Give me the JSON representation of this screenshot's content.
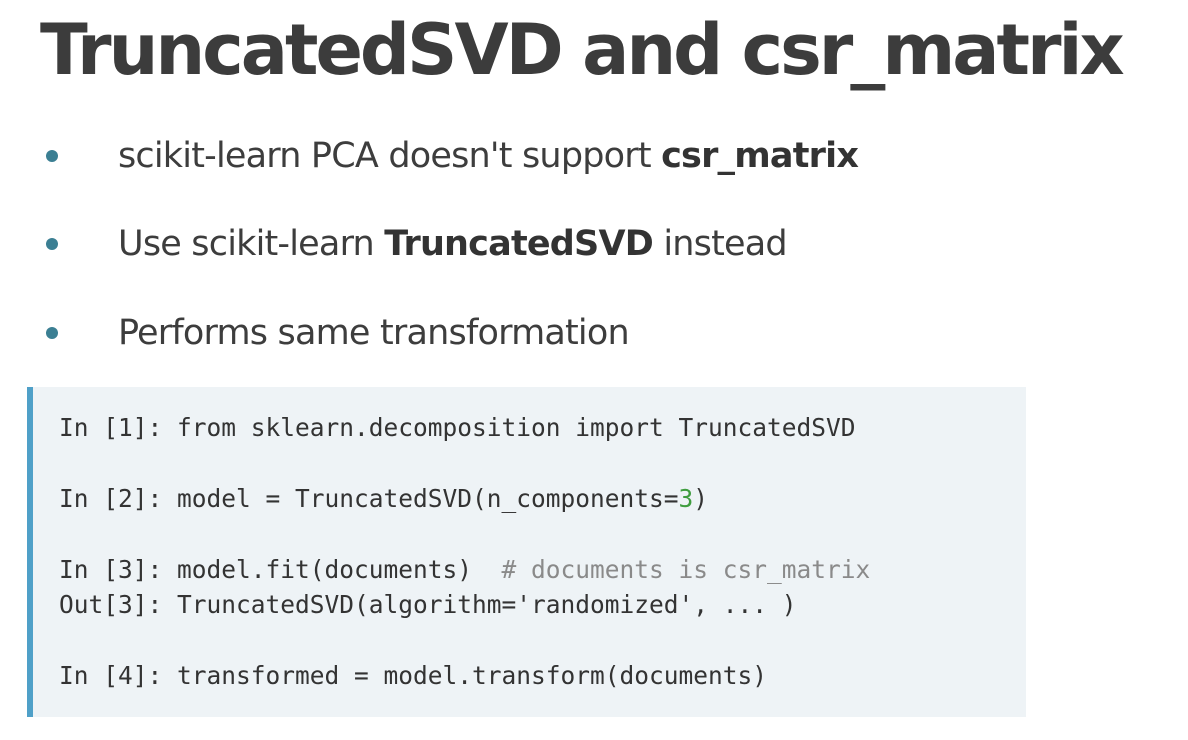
{
  "slide": {
    "title": "TruncatedSVD and csr_matrix",
    "bullets": [
      {
        "text_before": "scikit-learn PCA doesn't support ",
        "bold": "csr_matrix",
        "text_after": ""
      },
      {
        "text_before": "Use scikit-learn ",
        "bold": "TruncatedSVD",
        "text_after": " instead"
      },
      {
        "text_before": "Performs same transformation",
        "bold": "",
        "text_after": ""
      }
    ],
    "colors": {
      "bullet_dot": "#3b7f93",
      "code_background": "#eef3f6",
      "code_border": "#4fa0c8",
      "number_literal": "#3f9d3f",
      "comment": "#8a8a8a"
    }
  },
  "code": {
    "line1": {
      "prompt": "In [1]: ",
      "code": "from sklearn.decomposition import TruncatedSVD"
    },
    "line2": {
      "prompt": "In [2]: ",
      "code_before": "model = TruncatedSVD(n_components=",
      "number": "3",
      "code_after": ")"
    },
    "line3": {
      "prompt": "In [3]: ",
      "code": "model.fit(documents)  ",
      "comment": "# documents is csr_matrix"
    },
    "line4": {
      "prompt": "Out[3]: ",
      "code": "TruncatedSVD(algorithm='randomized', ... )"
    },
    "line5": {
      "prompt": "In [4]: ",
      "code": "transformed = model.transform(documents)"
    }
  }
}
